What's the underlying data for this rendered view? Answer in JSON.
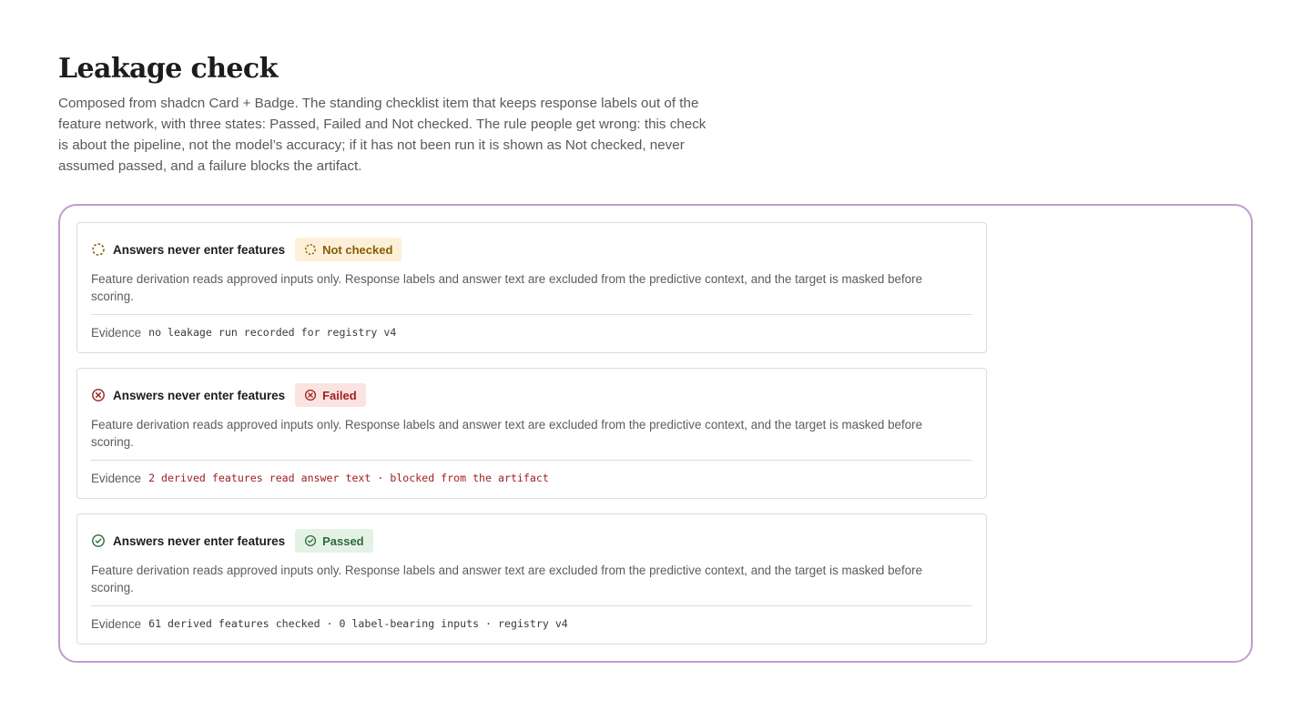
{
  "header": {
    "title": "Leakage check",
    "description": "Composed from shadcn Card + Badge. The standing checklist item that keeps response labels out of the feature network, with three states: Passed, Failed and Not checked. The rule people get wrong: this check is about the pipeline, not the model’s accuracy; if it has not been run it is shown as Not checked, never assumed passed, and a failure blocks the artifact."
  },
  "colors": {
    "frame_border": "#c39bd3",
    "not_checked": "#8a5a00",
    "not_checked_bg": "#fdf0d9",
    "failed": "#9c1f1f",
    "failed_bg": "#fbe3e1",
    "passed": "#2c6b3a",
    "passed_bg": "#e4f2e6"
  },
  "cards": [
    {
      "state": "not-checked",
      "icon": "dashed-circle-icon",
      "title": "Answers never enter features",
      "badge": "Not checked",
      "description": "Feature derivation reads approved inputs only. Response labels and answer text are excluded from the predictive context, and the target is masked before scoring.",
      "evidence_label": "Evidence",
      "evidence_value": "no leakage run recorded for registry v4"
    },
    {
      "state": "failed",
      "icon": "x-circle-icon",
      "title": "Answers never enter features",
      "badge": "Failed",
      "description": "Feature derivation reads approved inputs only. Response labels and answer text are excluded from the predictive context, and the target is masked before scoring.",
      "evidence_label": "Evidence",
      "evidence_value": "2 derived features read answer text · blocked from the artifact"
    },
    {
      "state": "passed",
      "icon": "check-circle-icon",
      "title": "Answers never enter features",
      "badge": "Passed",
      "description": "Feature derivation reads approved inputs only. Response labels and answer text are excluded from the predictive context, and the target is masked before scoring.",
      "evidence_label": "Evidence",
      "evidence_value": "61 derived features checked · 0 label-bearing inputs · registry v4"
    }
  ]
}
